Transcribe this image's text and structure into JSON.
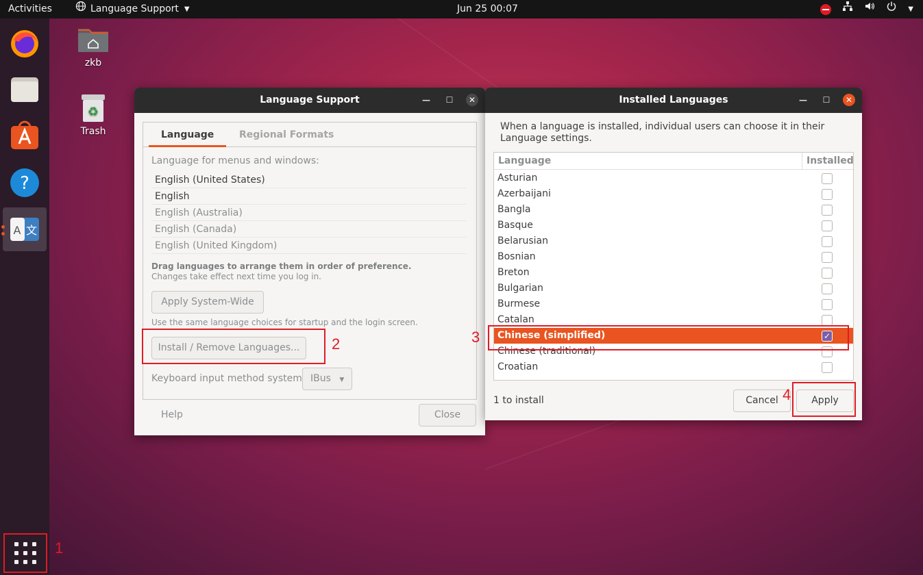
{
  "topbar": {
    "activities": "Activities",
    "app_name": "Language Support",
    "clock": "Jun 25  00:07"
  },
  "desktop": {
    "home_label": "zkb",
    "trash_label": "Trash"
  },
  "annotations": [
    "1",
    "2",
    "3",
    "4"
  ],
  "language_support": {
    "title": "Language Support",
    "tabs": [
      "Language",
      "Regional Formats"
    ],
    "menus_label": "Language for menus and windows:",
    "languages": [
      "English (United States)",
      "English",
      "English (Australia)",
      "English (Canada)",
      "English (United Kingdom)"
    ],
    "drag_hint": "Drag languages to arrange them in order of preference.",
    "changes_hint": "Changes take effect next time you log in.",
    "apply_system_wide": "Apply System-Wide",
    "same_choices_hint": "Use the same language choices for startup and the login screen.",
    "install_remove": "Install / Remove Languages...",
    "keyboard_label": "Keyboard input method system:",
    "keyboard_value": "IBus",
    "help": "Help",
    "close": "Close"
  },
  "installed_languages": {
    "title": "Installed Languages",
    "description": "When a language is installed, individual users can choose it in their Language settings.",
    "col_language": "Language",
    "col_installed": "Installed",
    "rows": [
      {
        "name": "Asturian",
        "checked": false
      },
      {
        "name": "Azerbaijani",
        "checked": false
      },
      {
        "name": "Bangla",
        "checked": false
      },
      {
        "name": "Basque",
        "checked": false
      },
      {
        "name": "Belarusian",
        "checked": false
      },
      {
        "name": "Bosnian",
        "checked": false
      },
      {
        "name": "Breton",
        "checked": false
      },
      {
        "name": "Bulgarian",
        "checked": false
      },
      {
        "name": "Burmese",
        "checked": false
      },
      {
        "name": "Catalan",
        "checked": false
      },
      {
        "name": "Chinese (simplified)",
        "checked": true
      },
      {
        "name": "Chinese (traditional)",
        "checked": false
      },
      {
        "name": "Croatian",
        "checked": false
      }
    ],
    "status": "1 to install",
    "cancel": "Cancel",
    "apply": "Apply"
  },
  "colors": {
    "accent": "#e95420",
    "annotation": "#e01b24",
    "topbar": "#151515"
  }
}
